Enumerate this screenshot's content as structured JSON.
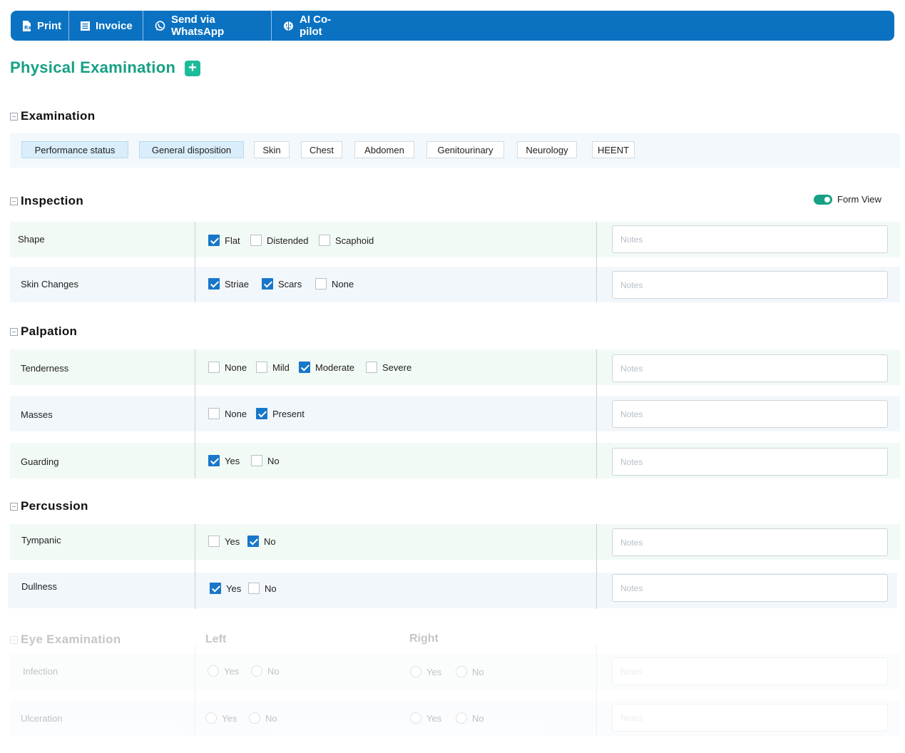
{
  "toolbar": {
    "print": "Print",
    "invoice": "Invoice",
    "whatsapp": "Send via WhatsApp",
    "copilot": "AI Co-pilot"
  },
  "page_title": "Physical Examination",
  "add_label": "+",
  "examination": {
    "title": "Examination",
    "tabs": [
      "Performance status",
      "General disposition",
      "Skin",
      "Chest",
      "Abdomen",
      "Genitourinary",
      "Neurology",
      "HEENT"
    ],
    "active_tabs": [
      "Performance status",
      "General disposition"
    ]
  },
  "form_view_label": "Form View",
  "notes_placeholder": "Notes",
  "inspection": {
    "title": "Inspection",
    "rows": [
      {
        "label": "Shape",
        "options": [
          {
            "label": "Flat",
            "checked": true
          },
          {
            "label": "Distended",
            "checked": false
          },
          {
            "label": "Scaphoid",
            "checked": false
          }
        ]
      },
      {
        "label": "Skin Changes",
        "options": [
          {
            "label": "Striae",
            "checked": true
          },
          {
            "label": "Scars",
            "checked": true
          },
          {
            "label": "None",
            "checked": false
          }
        ]
      }
    ]
  },
  "palpation": {
    "title": "Palpation",
    "rows": [
      {
        "label": "Tenderness",
        "options": [
          {
            "label": "None",
            "checked": false
          },
          {
            "label": "Mild",
            "checked": false
          },
          {
            "label": "Moderate",
            "checked": true
          },
          {
            "label": "Severe",
            "checked": false
          }
        ]
      },
      {
        "label": "Masses",
        "options": [
          {
            "label": "None",
            "checked": false
          },
          {
            "label": "Present",
            "checked": true
          }
        ]
      },
      {
        "label": "Guarding",
        "options": [
          {
            "label": "Yes",
            "checked": true
          },
          {
            "label": "No",
            "checked": false
          }
        ]
      }
    ]
  },
  "percussion": {
    "title": "Percussion",
    "rows": [
      {
        "label": "Tympanic",
        "options": [
          {
            "label": "Yes",
            "checked": false
          },
          {
            "label": "No",
            "checked": true
          }
        ]
      },
      {
        "label": "Dullness",
        "options": [
          {
            "label": "Yes",
            "checked": true
          },
          {
            "label": "No",
            "checked": false
          }
        ]
      }
    ]
  },
  "eye_exam": {
    "title": "Eye Examination",
    "left_header": "Left",
    "right_header": "Right",
    "rows": [
      {
        "label": "Infection",
        "left": [
          "Yes",
          "No"
        ],
        "right": [
          "Yes",
          "No"
        ]
      },
      {
        "label": "Ulceration",
        "left": [
          "Yes",
          "No"
        ],
        "right": [
          "Yes",
          "No"
        ]
      }
    ]
  }
}
